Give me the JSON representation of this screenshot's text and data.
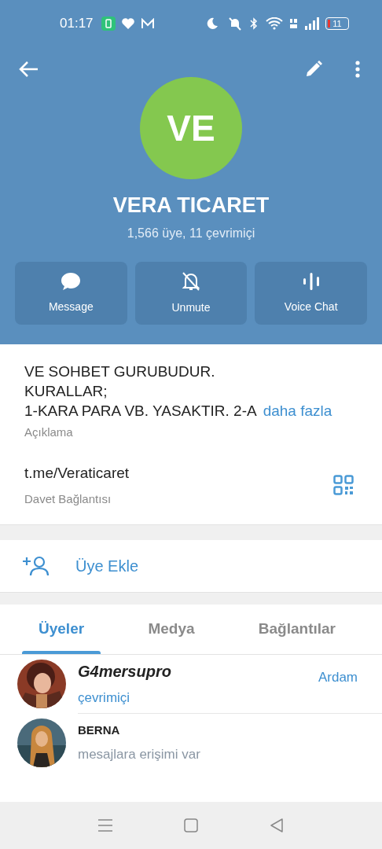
{
  "status_bar": {
    "time": "01:17",
    "battery": "11"
  },
  "header": {
    "avatar_initials": "VE",
    "title": "VERA TICARET",
    "subtitle": "1,566 üye, 11 çevrimiçi"
  },
  "actions": [
    {
      "kind": "message",
      "label": "Message"
    },
    {
      "kind": "unmute",
      "label": "Unmute"
    },
    {
      "kind": "voice",
      "label": "Voice Chat"
    }
  ],
  "info": {
    "description_lines": [
      "VE SOHBET GURUBUDUR.",
      "KURALLAR;",
      "1-KARA PARA VB. YASAKTIR. 2-A"
    ],
    "more": "daha fazla",
    "description_label": "Açıklama",
    "link": "t.me/Veraticaret",
    "link_label": "Davet Bağlantısı"
  },
  "add_member": {
    "label": "Üye Ekle"
  },
  "tabs": [
    {
      "label": "Üyeler",
      "selected": true
    },
    {
      "label": "Medya",
      "selected": false
    },
    {
      "label": "Bağlantılar",
      "selected": false
    }
  ],
  "members": [
    {
      "name": "G4mersupro",
      "italic": true,
      "status": "çevrimiçi",
      "online": true,
      "role": "Ardam"
    },
    {
      "name": "BERNA",
      "italic": false,
      "status": "mesajlara erişimi var",
      "online": false
    }
  ]
}
